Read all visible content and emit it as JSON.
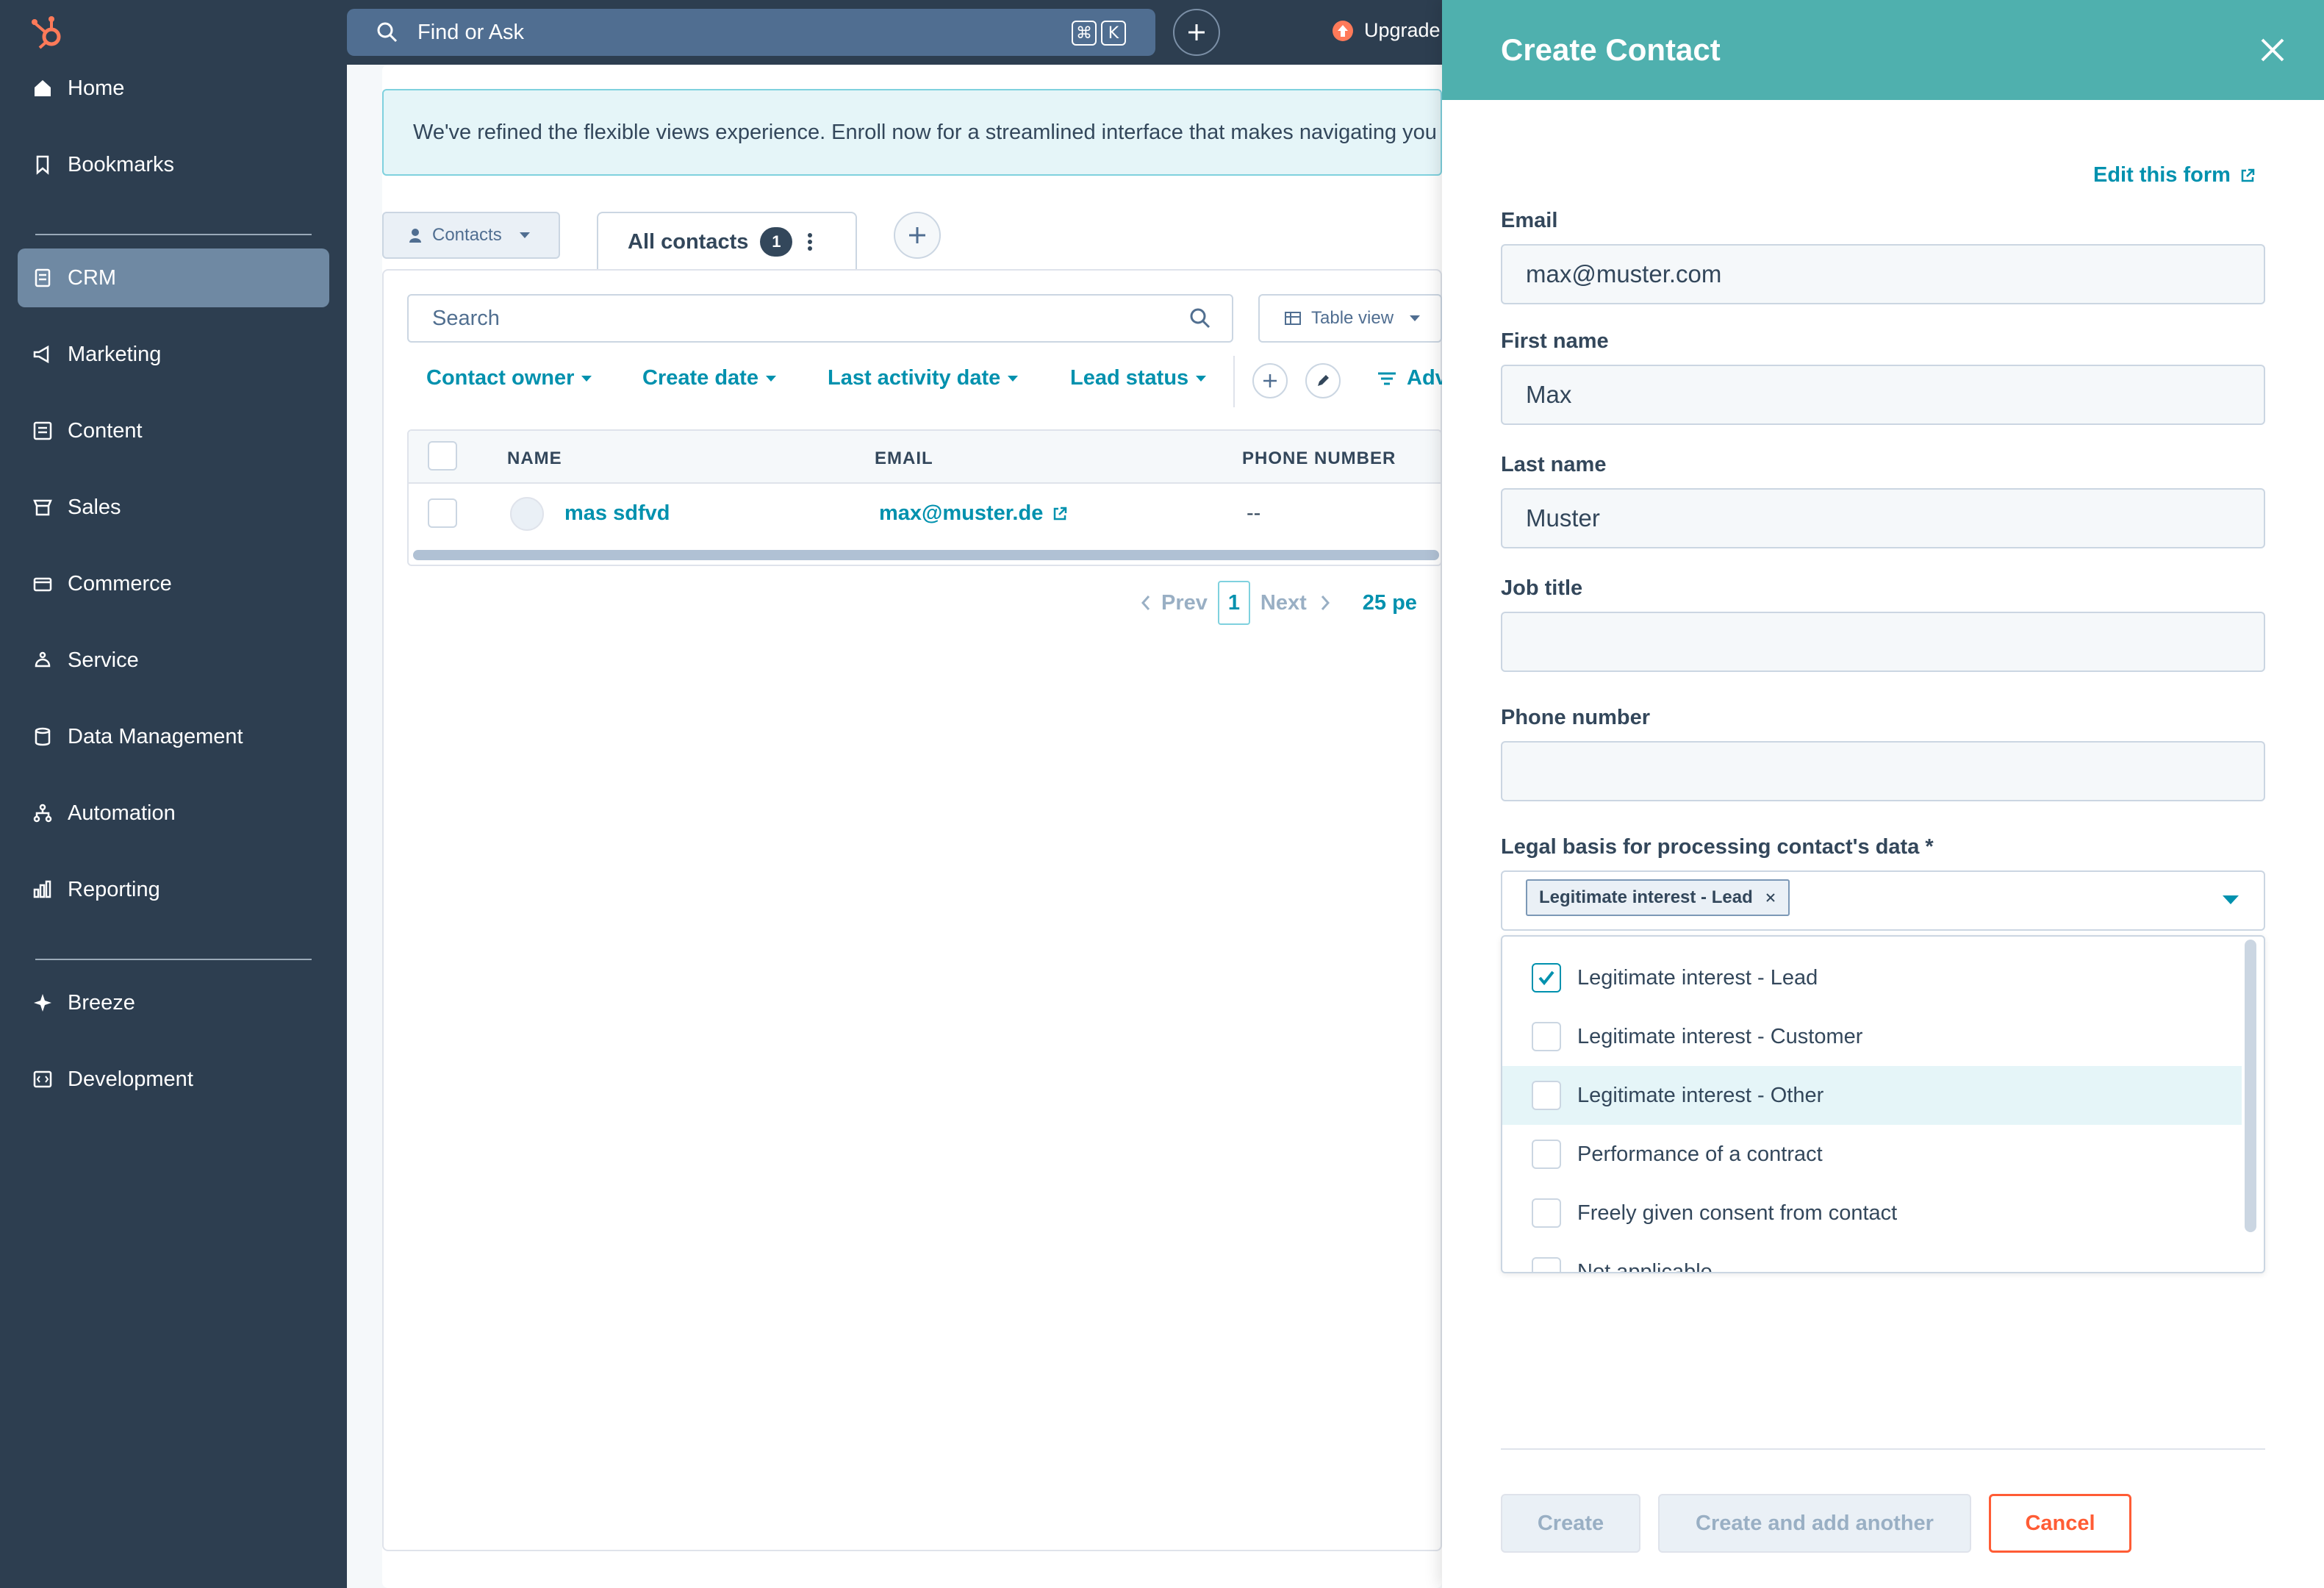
{
  "sidebar": {
    "items": [
      {
        "label": "Home",
        "icon": "home-icon"
      },
      {
        "label": "Bookmarks",
        "icon": "bookmark-icon"
      },
      {
        "label": "CRM",
        "icon": "crm-icon"
      },
      {
        "label": "Marketing",
        "icon": "megaphone-icon"
      },
      {
        "label": "Content",
        "icon": "content-icon"
      },
      {
        "label": "Sales",
        "icon": "sales-icon"
      },
      {
        "label": "Commerce",
        "icon": "commerce-icon"
      },
      {
        "label": "Service",
        "icon": "service-icon"
      },
      {
        "label": "Data Management",
        "icon": "database-icon"
      },
      {
        "label": "Automation",
        "icon": "automation-icon"
      },
      {
        "label": "Reporting",
        "icon": "reporting-icon"
      },
      {
        "label": "Breeze",
        "icon": "sparkle-icon"
      },
      {
        "label": "Development",
        "icon": "code-icon"
      }
    ],
    "active": "CRM"
  },
  "topbar": {
    "search_placeholder": "Find or Ask",
    "shortcut_keys": [
      "⌘",
      "K"
    ],
    "upgrade_label": "Upgrade"
  },
  "banner": {
    "text": "We've refined the flexible views experience. Enroll now for a streamlined interface that makes navigating you"
  },
  "object_selector": {
    "label": "Contacts"
  },
  "view_tab": {
    "label": "All contacts",
    "count": "1"
  },
  "table_search": {
    "placeholder": "Search"
  },
  "table_view": {
    "label": "Table view"
  },
  "filters": [
    {
      "label": "Contact owner"
    },
    {
      "label": "Create date"
    },
    {
      "label": "Last activity date"
    },
    {
      "label": "Lead status"
    }
  ],
  "advanced_filters_label": "Adv",
  "table": {
    "columns": [
      "NAME",
      "EMAIL",
      "PHONE NUMBER"
    ],
    "rows": [
      {
        "name": "mas sdfvd",
        "email": "max@muster.de",
        "phone": "--"
      }
    ]
  },
  "pagination": {
    "prev": "Prev",
    "page": "1",
    "next": "Next",
    "per_page": "25 pe"
  },
  "panel": {
    "title": "Create Contact",
    "edit_form_label": "Edit this form",
    "fields": {
      "email": {
        "label": "Email",
        "value": "max@muster.com"
      },
      "first_name": {
        "label": "First name",
        "value": "Max"
      },
      "last_name": {
        "label": "Last name",
        "value": "Muster"
      },
      "job_title": {
        "label": "Job title",
        "value": ""
      },
      "phone": {
        "label": "Phone number",
        "value": ""
      }
    },
    "legal_basis": {
      "label": "Legal basis for processing contact's data *",
      "selected_tag": "Legitimate interest - Lead",
      "options": [
        {
          "label": "Legitimate interest - Lead",
          "checked": true
        },
        {
          "label": "Legitimate interest - Customer",
          "checked": false
        },
        {
          "label": "Legitimate interest - Other",
          "checked": false,
          "highlighted": true
        },
        {
          "label": "Performance of a contract",
          "checked": false
        },
        {
          "label": "Freely given consent from contact",
          "checked": false
        },
        {
          "label": "Not applicable",
          "checked": false
        }
      ]
    },
    "buttons": {
      "create": "Create",
      "create_another": "Create and add another",
      "cancel": "Cancel"
    }
  },
  "colors": {
    "sidebar_bg": "#2d3e50",
    "accent_teal": "#0091ae",
    "panel_header": "#4fb0ae",
    "brand_orange": "#ff7a59"
  }
}
